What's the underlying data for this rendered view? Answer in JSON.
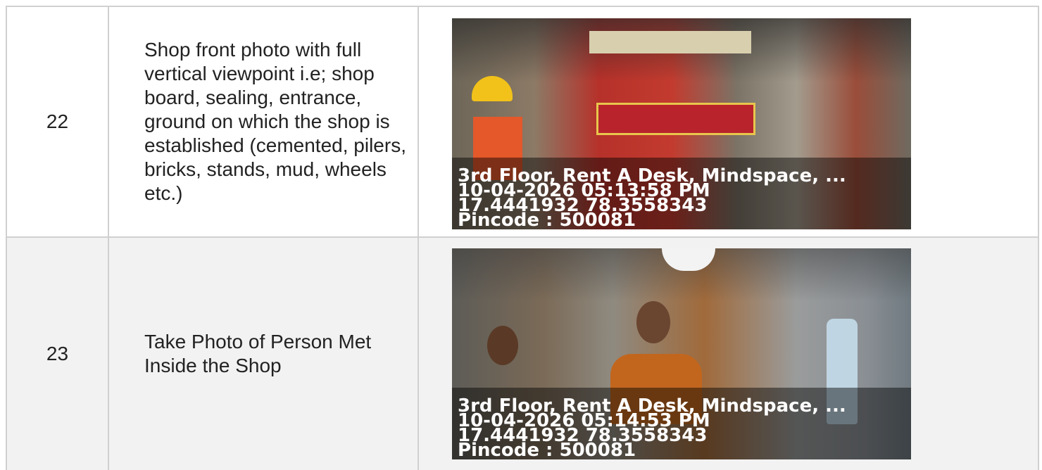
{
  "rows": [
    {
      "number": "22",
      "description": "Shop front photo with full vertical viewpoint i.e; shop board, sealing, entrance, ground on which the shop is established (cemented, pilers, bricks, stands, mud, wheels etc.)",
      "photo": {
        "address": "3rd Floor, Rent A Desk, Mindspace, ...",
        "datetime": "10-04-2026 05:13:58 PM",
        "coordinates": "17.4441932 78.3558343",
        "pincode": "Pincode : 500081"
      }
    },
    {
      "number": "23",
      "description": "Take Photo of Person Met Inside the Shop",
      "photo": {
        "address": "3rd Floor, Rent A Desk, Mindspace, ...",
        "datetime": "10-04-2026 05:14:53 PM",
        "coordinates": "17.4441932 78.3558343",
        "pincode": "Pincode : 500081"
      }
    }
  ]
}
